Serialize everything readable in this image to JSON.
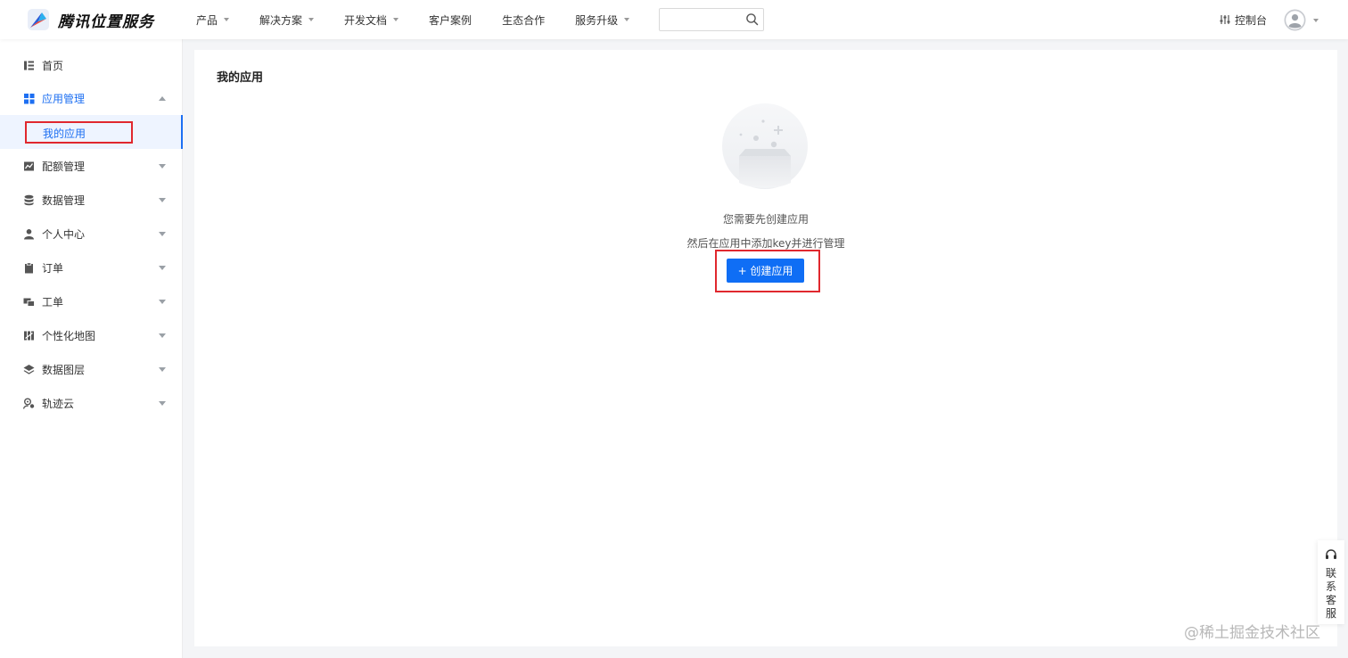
{
  "brand": {
    "name": "腾讯位置服务"
  },
  "nav": {
    "items": [
      {
        "label": "产品",
        "has_dropdown": true
      },
      {
        "label": "解决方案",
        "has_dropdown": true
      },
      {
        "label": "开发文档",
        "has_dropdown": true
      },
      {
        "label": "客户案例",
        "has_dropdown": false
      },
      {
        "label": "生态合作",
        "has_dropdown": false
      },
      {
        "label": "服务升级",
        "has_dropdown": true
      }
    ],
    "search": {
      "value": "",
      "placeholder": ""
    },
    "console_label": "控制台"
  },
  "sidebar": {
    "items": [
      {
        "label": "首页",
        "icon": "list-icon",
        "expandable": false
      },
      {
        "label": "应用管理",
        "icon": "grid-icon",
        "expandable": true,
        "expanded": true,
        "active": true
      },
      {
        "label": "配额管理",
        "icon": "chart-icon",
        "expandable": true
      },
      {
        "label": "数据管理",
        "icon": "database-icon",
        "expandable": true
      },
      {
        "label": "个人中心",
        "icon": "user-icon",
        "expandable": true
      },
      {
        "label": "订单",
        "icon": "clipboard-icon",
        "expandable": true
      },
      {
        "label": "工单",
        "icon": "ticket-icon",
        "expandable": true
      },
      {
        "label": "个性化地图",
        "icon": "map-icon",
        "expandable": true
      },
      {
        "label": "数据图层",
        "icon": "layers-icon",
        "expandable": true
      },
      {
        "label": "轨迹云",
        "icon": "location-person-icon",
        "expandable": true
      }
    ],
    "sub_item": {
      "label": "我的应用",
      "selected": true
    }
  },
  "main": {
    "title": "我的应用",
    "empty_line1": "您需要先创建应用",
    "empty_line2": "然后在应用中添加key并进行管理",
    "create_button": "+ 创建应用"
  },
  "contact": {
    "label": "联系客服"
  },
  "watermark": "@稀土掘金技术社区",
  "colors": {
    "accent": "#0f6ef5",
    "highlight": "#e0282e",
    "sidebar_active_bg": "#eef4ff"
  }
}
